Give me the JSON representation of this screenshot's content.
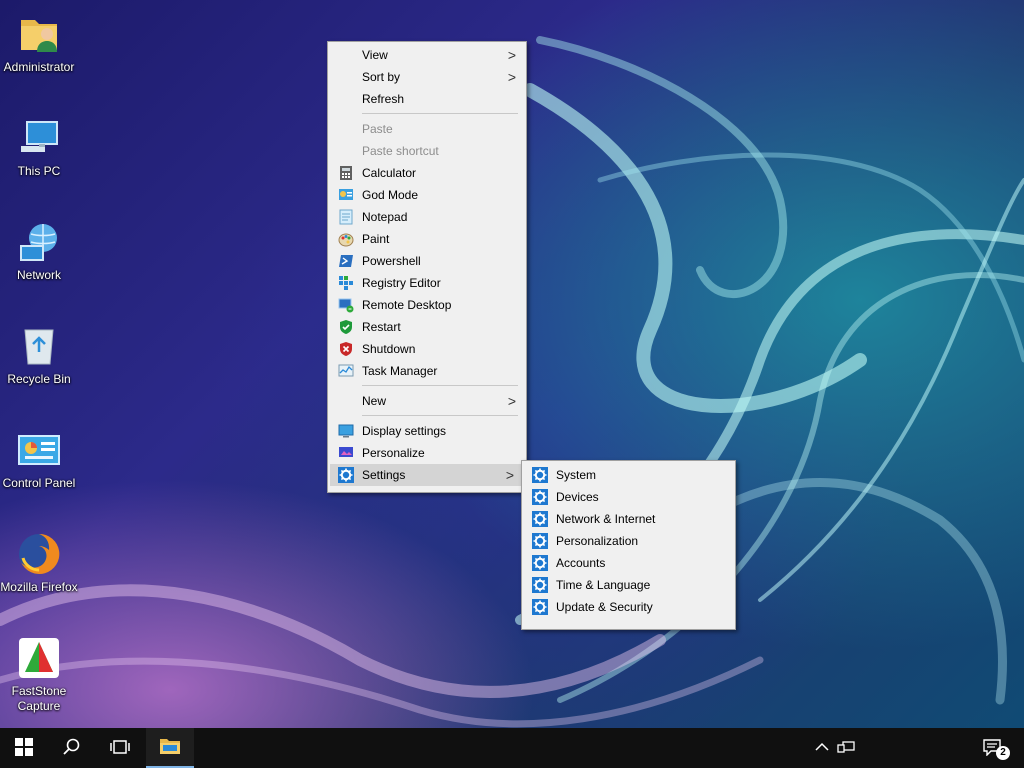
{
  "desktop": {
    "icons": [
      {
        "label": "Administrator"
      },
      {
        "label": "This PC"
      },
      {
        "label": "Network"
      },
      {
        "label": "Recycle Bin"
      },
      {
        "label": "Control Panel"
      },
      {
        "label": "Mozilla Firefox"
      },
      {
        "label": "FastStone Capture"
      }
    ]
  },
  "context_menu": {
    "items": [
      {
        "label": "View"
      },
      {
        "label": "Sort by"
      },
      {
        "label": "Refresh"
      },
      {
        "label": "Paste"
      },
      {
        "label": "Paste shortcut"
      },
      {
        "label": "Calculator"
      },
      {
        "label": "God Mode"
      },
      {
        "label": "Notepad"
      },
      {
        "label": "Paint"
      },
      {
        "label": "Powershell"
      },
      {
        "label": "Registry Editor"
      },
      {
        "label": "Remote Desktop"
      },
      {
        "label": "Restart"
      },
      {
        "label": "Shutdown"
      },
      {
        "label": "Task Manager"
      },
      {
        "label": "New"
      },
      {
        "label": "Display settings"
      },
      {
        "label": "Personalize"
      },
      {
        "label": "Settings"
      }
    ],
    "submenu_arrow": ">"
  },
  "settings_submenu": {
    "items": [
      {
        "label": "System"
      },
      {
        "label": "Devices"
      },
      {
        "label": "Network & Internet"
      },
      {
        "label": "Personalization"
      },
      {
        "label": "Accounts"
      },
      {
        "label": "Time & Language"
      },
      {
        "label": "Update & Security"
      }
    ]
  },
  "taskbar": {
    "notification_count": "2",
    "accent_color": "#7fb4e6"
  }
}
